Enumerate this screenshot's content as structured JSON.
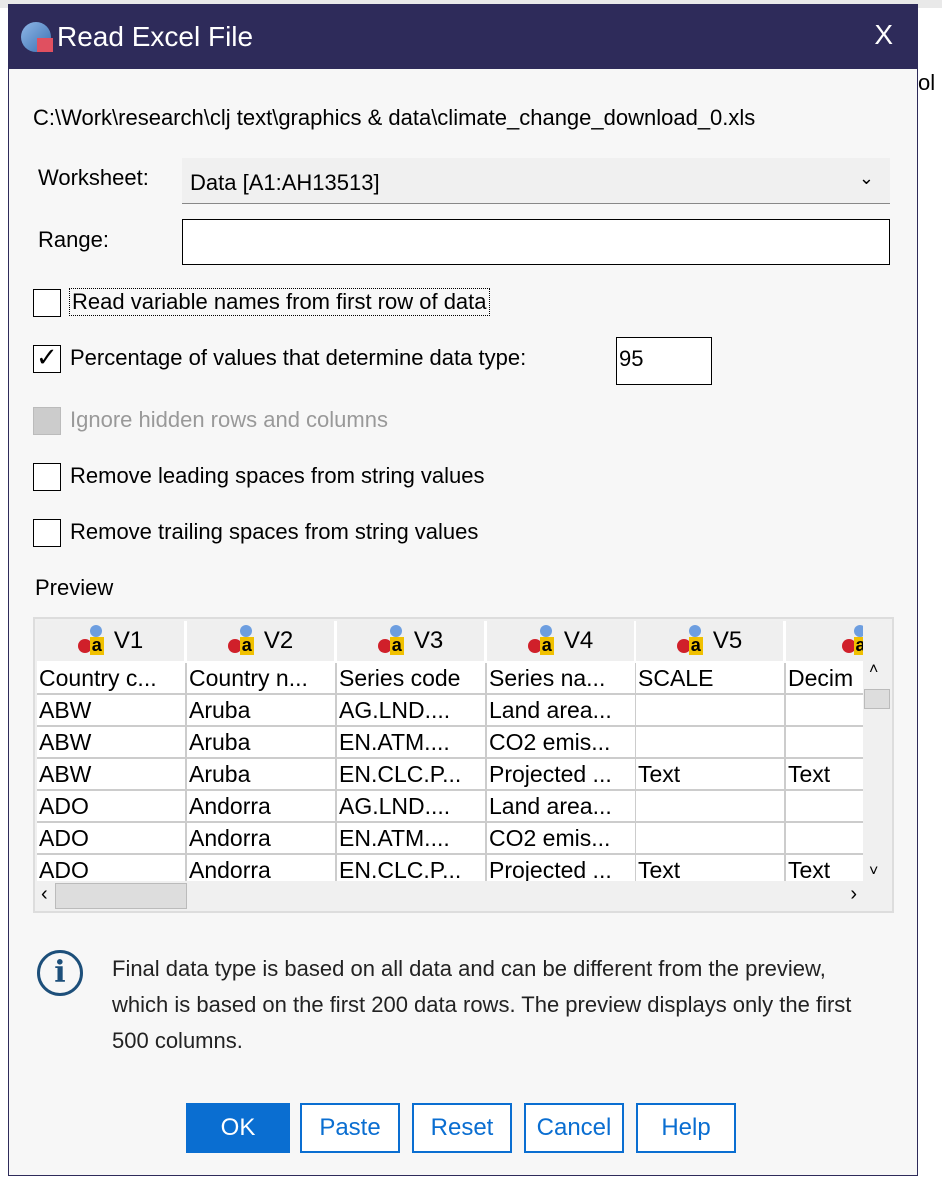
{
  "window": {
    "title": "Read Excel File",
    "close": "X",
    "background_fragment": "ol"
  },
  "file_path": "C:\\Work\\research\\clj text\\graphics & data\\climate_change_download_0.xls",
  "worksheet": {
    "label": "Worksheet:",
    "value": "Data [A1:AH13513]"
  },
  "range": {
    "label": "Range:",
    "value": ""
  },
  "options": [
    {
      "label": "Read variable names from first row of data",
      "checked": false,
      "enabled": true
    },
    {
      "label": "Percentage of values that determine data type:",
      "checked": true,
      "enabled": true
    },
    {
      "label": "Ignore hidden rows and columns",
      "checked": false,
      "enabled": false
    },
    {
      "label": "Remove leading spaces from string values",
      "checked": false,
      "enabled": true
    },
    {
      "label": "Remove trailing spaces from string values",
      "checked": false,
      "enabled": true
    }
  ],
  "percentage_value": "95",
  "preview": {
    "label": "Preview",
    "headers": [
      "V1",
      "V2",
      "V3",
      "V4",
      "V5",
      ""
    ],
    "rows": [
      [
        "Country c...",
        "Country n...",
        "Series code",
        "Series na...",
        "SCALE",
        "Decim"
      ],
      [
        "ABW",
        "Aruba",
        "AG.LND....",
        "Land area...",
        "",
        ""
      ],
      [
        "ABW",
        "Aruba",
        "EN.ATM....",
        "CO2 emis...",
        "",
        ""
      ],
      [
        "ABW",
        "Aruba",
        "EN.CLC.P...",
        "Projected ...",
        "Text",
        "Text"
      ],
      [
        "ADO",
        "Andorra",
        "AG.LND....",
        "Land area...",
        "",
        ""
      ],
      [
        "ADO",
        "Andorra",
        "EN.ATM....",
        "CO2 emis...",
        "",
        ""
      ],
      [
        "ADO",
        "Andorra",
        "EN.CLC.P...",
        "Projected ...",
        "Text",
        "Text"
      ]
    ]
  },
  "info_text": "Final data type is based on all data and can be different from the preview, which is based on the first 200 data rows. The preview displays only the first 500 columns.",
  "buttons": {
    "ok": "OK",
    "paste": "Paste",
    "reset": "Reset",
    "cancel": "Cancel",
    "help": "Help"
  },
  "colors": {
    "titlebar": "#2e2b5a",
    "accent": "#0a6ed1"
  }
}
